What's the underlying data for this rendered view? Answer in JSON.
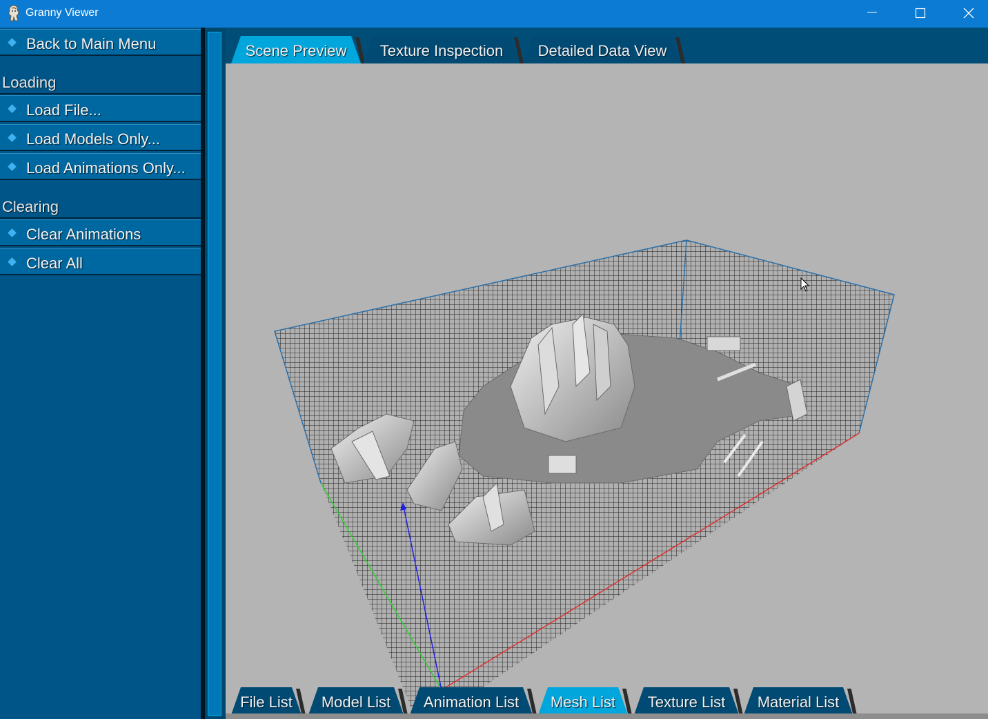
{
  "window": {
    "title": "Granny Viewer",
    "controls": [
      "minimize-icon",
      "maximize-icon",
      "close-icon"
    ]
  },
  "sidebar": {
    "back_button": "Back to Main Menu",
    "sections": [
      {
        "heading": "Loading",
        "items": [
          "Load File...",
          "Load Models Only...",
          "Load Animations Only..."
        ]
      },
      {
        "heading": "Clearing",
        "items": [
          "Clear Animations",
          "Clear All"
        ]
      }
    ]
  },
  "top_tabs": [
    {
      "label": "Scene Preview",
      "active": true
    },
    {
      "label": "Texture Inspection",
      "active": false
    },
    {
      "label": "Detailed Data View",
      "active": false
    }
  ],
  "bottom_tabs": [
    {
      "label": "File List",
      "active": false
    },
    {
      "label": "Model List",
      "active": false
    },
    {
      "label": "Animation List",
      "active": false
    },
    {
      "label": "Mesh List",
      "active": true
    },
    {
      "label": "Texture List",
      "active": false
    },
    {
      "label": "Material List",
      "active": false
    }
  ],
  "colors": {
    "title_bar": "#0b7bd4",
    "panel": "#005588",
    "active_tab": "#00a6dc",
    "viewport_bg": "#b4b4b4",
    "axis_x": "#e03030",
    "axis_y": "#30d030",
    "axis_z": "#2020e0"
  }
}
